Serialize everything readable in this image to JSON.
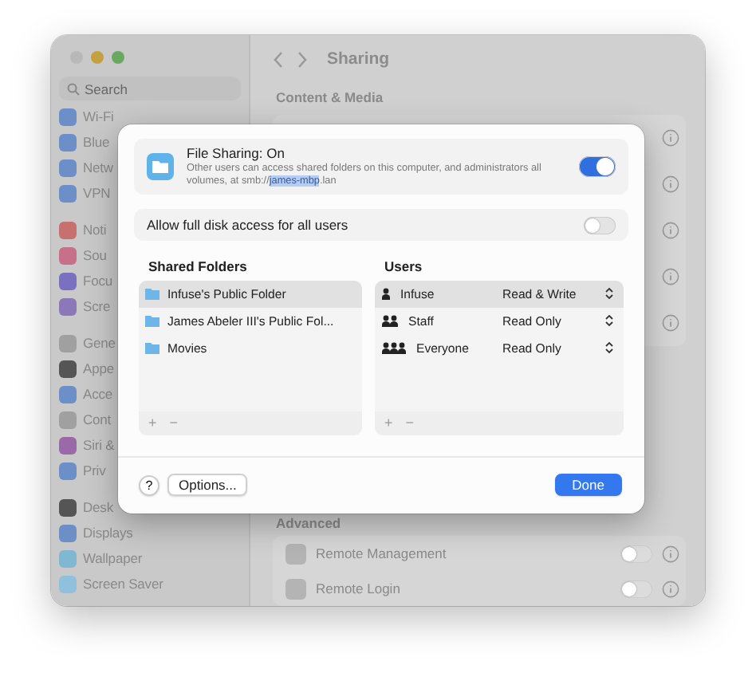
{
  "window": {
    "sidebar": {
      "search": {
        "placeholder": "Search"
      },
      "groups": [
        {
          "items": [
            {
              "label": "Wi-Fi",
              "color": "#6d8fc7"
            },
            {
              "label": "Blue",
              "color": "#6d8fc7"
            },
            {
              "label": "Netw",
              "color": "#6d8fc7"
            },
            {
              "label": "VPN",
              "color": "#6d8fc7"
            }
          ]
        },
        {
          "items": [
            {
              "label": "Noti",
              "color": "#c77070"
            },
            {
              "label": "Sou",
              "color": "#c7708a"
            },
            {
              "label": "Focu",
              "color": "#7a70c0"
            },
            {
              "label": "Scre",
              "color": "#8a78b8"
            }
          ]
        },
        {
          "items": [
            {
              "label": "Gene",
              "color": "#a0a0a0"
            },
            {
              "label": "Appe",
              "color": "#555555"
            },
            {
              "label": "Acce",
              "color": "#6d8fc7"
            },
            {
              "label": "Cont",
              "color": "#a0a0a0"
            },
            {
              "label": "Siri &",
              "color": "#9a6aa8"
            },
            {
              "label": "Priv",
              "color": "#6d8fc7"
            }
          ]
        },
        {
          "items": [
            {
              "label": "Desk",
              "color": "#555555"
            },
            {
              "label": "Displays",
              "color": "#6d8fc7"
            },
            {
              "label": "Wallpaper",
              "color": "#7fb8d0"
            },
            {
              "label": "Screen Saver",
              "color": "#8fc0dc"
            }
          ]
        }
      ]
    },
    "toolbar": {
      "title": "Sharing"
    },
    "content": {
      "section_title": "Content & Media",
      "advanced_title": "Advanced",
      "advanced_rows": [
        {
          "label": "Remote Management",
          "on": false
        },
        {
          "label": "Remote Login",
          "on": false
        }
      ]
    }
  },
  "dialog": {
    "file_sharing": {
      "title": "File Sharing: On",
      "description_before": "Other users can access shared folders on this computer, and administrators all volumes, at smb://",
      "description_selection": "james-mbp",
      "description_after": ".lan",
      "on": true
    },
    "full_disk_access": {
      "label": "Allow full disk access for all users",
      "on": false
    },
    "shared_folders": {
      "title": "Shared Folders",
      "items": [
        {
          "name": "Infuse's Public Folder",
          "selected": true
        },
        {
          "name": "James Abeler III's Public Fol...",
          "selected": false
        },
        {
          "name": "Movies",
          "selected": false
        }
      ],
      "add": "+",
      "remove": "−"
    },
    "users": {
      "title": "Users",
      "items": [
        {
          "name": "Infuse",
          "kind": "person",
          "permission": "Read & Write",
          "selected": true
        },
        {
          "name": "Staff",
          "kind": "group",
          "permission": "Read Only",
          "selected": false
        },
        {
          "name": "Everyone",
          "kind": "everyone",
          "permission": "Read Only",
          "selected": false
        }
      ],
      "add": "+",
      "remove": "−"
    },
    "help": "?",
    "options": "Options...",
    "done": "Done"
  }
}
